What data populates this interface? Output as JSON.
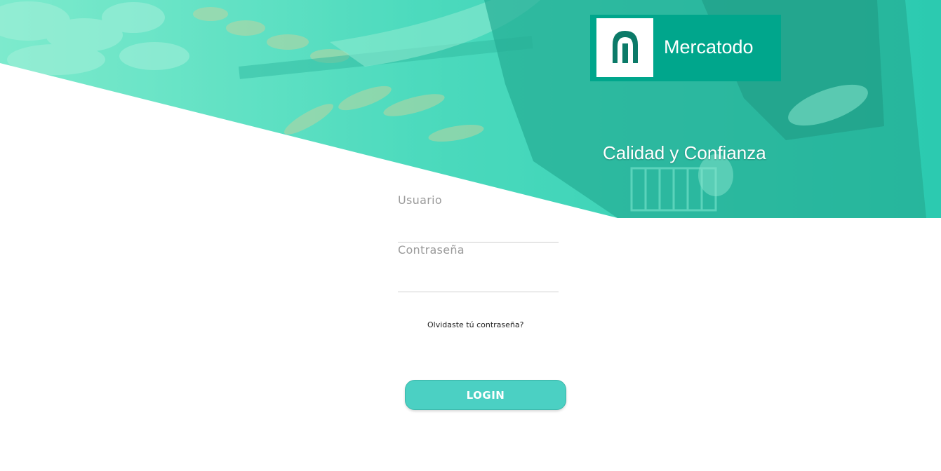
{
  "brand": {
    "name": "Mercatodo",
    "tagline": "Calidad y Confianza",
    "logo_icon": "mercatodo-arch-icon",
    "logo_color": "#00a68c"
  },
  "hero": {
    "overlay_color": "#2fd3b3",
    "description_icon": "produce-market-photo"
  },
  "form": {
    "username_label": "Usuario",
    "username_value": "",
    "password_label": "Contraseña",
    "password_value": "",
    "forgot_password": "Olvidaste tú contraseña?",
    "login_label": "LOGIN",
    "button_color": "#4bd0c3"
  }
}
